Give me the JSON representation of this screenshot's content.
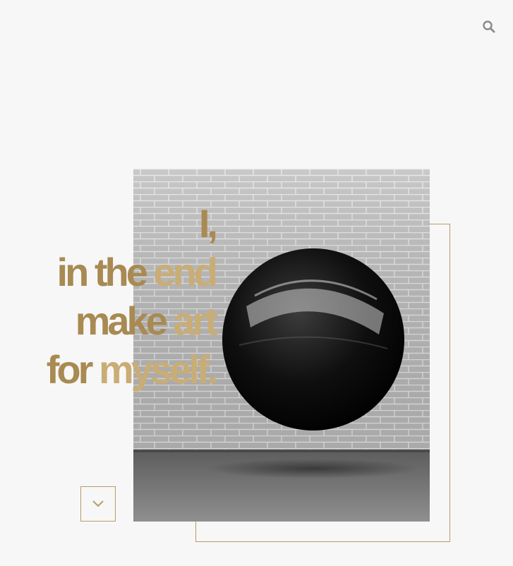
{
  "header": {
    "search_icon": "search-icon"
  },
  "hero": {
    "headline": {
      "line1": "I,",
      "line2_dark": "in the",
      "line2_gold": " end",
      "line3_dark": "make",
      "line3_gold": " art",
      "line4_dark": "for",
      "line4_gold": " myself."
    },
    "photo": "black glossy sphere floating in front of a painted brick wall",
    "scroll_icon": "chevron-down-icon"
  },
  "colors": {
    "background": "#f7f7f7",
    "accent_gold": "#b79c66",
    "headline_dark": "#a88a52",
    "headline_gold": "#c9ad75",
    "icon_gray": "#8a8a8a"
  }
}
